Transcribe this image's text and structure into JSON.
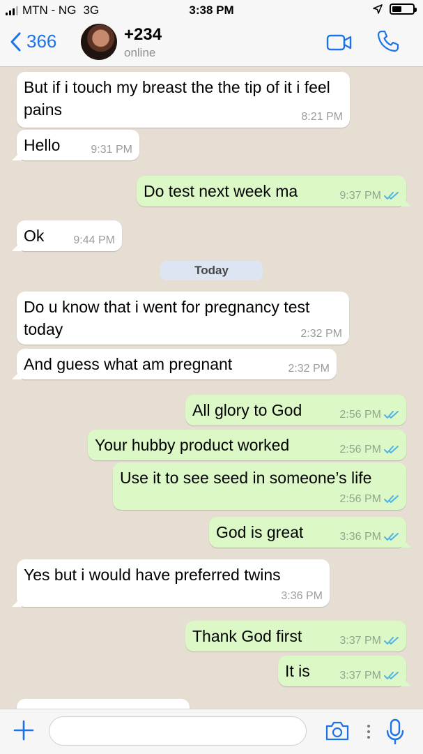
{
  "status_bar": {
    "carrier": "MTN - NG",
    "network": "3G",
    "time": "3:38 PM",
    "battery_level": 0.45
  },
  "nav": {
    "back_count": "366",
    "contact_name": "+234",
    "contact_status": "online",
    "accent_color": "#1a73e8"
  },
  "date_separator": "Today",
  "messages": [
    {
      "text": "But if i touch my breast the the tip of it i feel pains",
      "time": "8:21 PM",
      "direction": "incoming"
    },
    {
      "text": "Hello",
      "time": "9:31 PM",
      "direction": "incoming"
    },
    {
      "text": "Do test next week ma",
      "time": "9:37 PM",
      "direction": "outgoing",
      "read": true
    },
    {
      "text": "Ok",
      "time": "9:44 PM",
      "direction": "incoming"
    },
    {
      "text": "Do u know that i went for pregnancy test today",
      "time": "2:32 PM",
      "direction": "incoming"
    },
    {
      "text": "And guess what am pregnant",
      "time": "2:32 PM",
      "direction": "incoming"
    },
    {
      "text": "All glory to God",
      "time": "2:56 PM",
      "direction": "outgoing",
      "read": true
    },
    {
      "text": "Your hubby product worked",
      "time": "2:56 PM",
      "direction": "outgoing",
      "read": true
    },
    {
      "text": "Use it to see seed in someone’s life",
      "time": "2:56 PM",
      "direction": "outgoing",
      "read": true
    },
    {
      "text": "God is great",
      "time": "3:36 PM",
      "direction": "outgoing",
      "read": true
    },
    {
      "text": "Yes but i would have preferred twins",
      "time": "3:36 PM",
      "direction": "incoming"
    },
    {
      "text": "Thank God first",
      "time": "3:37 PM",
      "direction": "outgoing",
      "read": true
    },
    {
      "text": "It is",
      "time": "3:37 PM",
      "direction": "outgoing",
      "read": true
    }
  ],
  "colors": {
    "incoming_bubble": "#ffffff",
    "outgoing_bubble": "#dcf8c6",
    "read_ticks": "#4fb3e8",
    "chat_background": "#e6ddd3"
  },
  "icons": {
    "back": "chevron-left-icon",
    "video": "video-call-icon",
    "phone": "phone-call-icon",
    "attach": "plus-icon",
    "camera": "camera-icon",
    "more": "more-dots-icon",
    "mic": "microphone-icon",
    "location": "location-arrow-icon",
    "battery": "battery-icon"
  },
  "input": {
    "placeholder": ""
  }
}
